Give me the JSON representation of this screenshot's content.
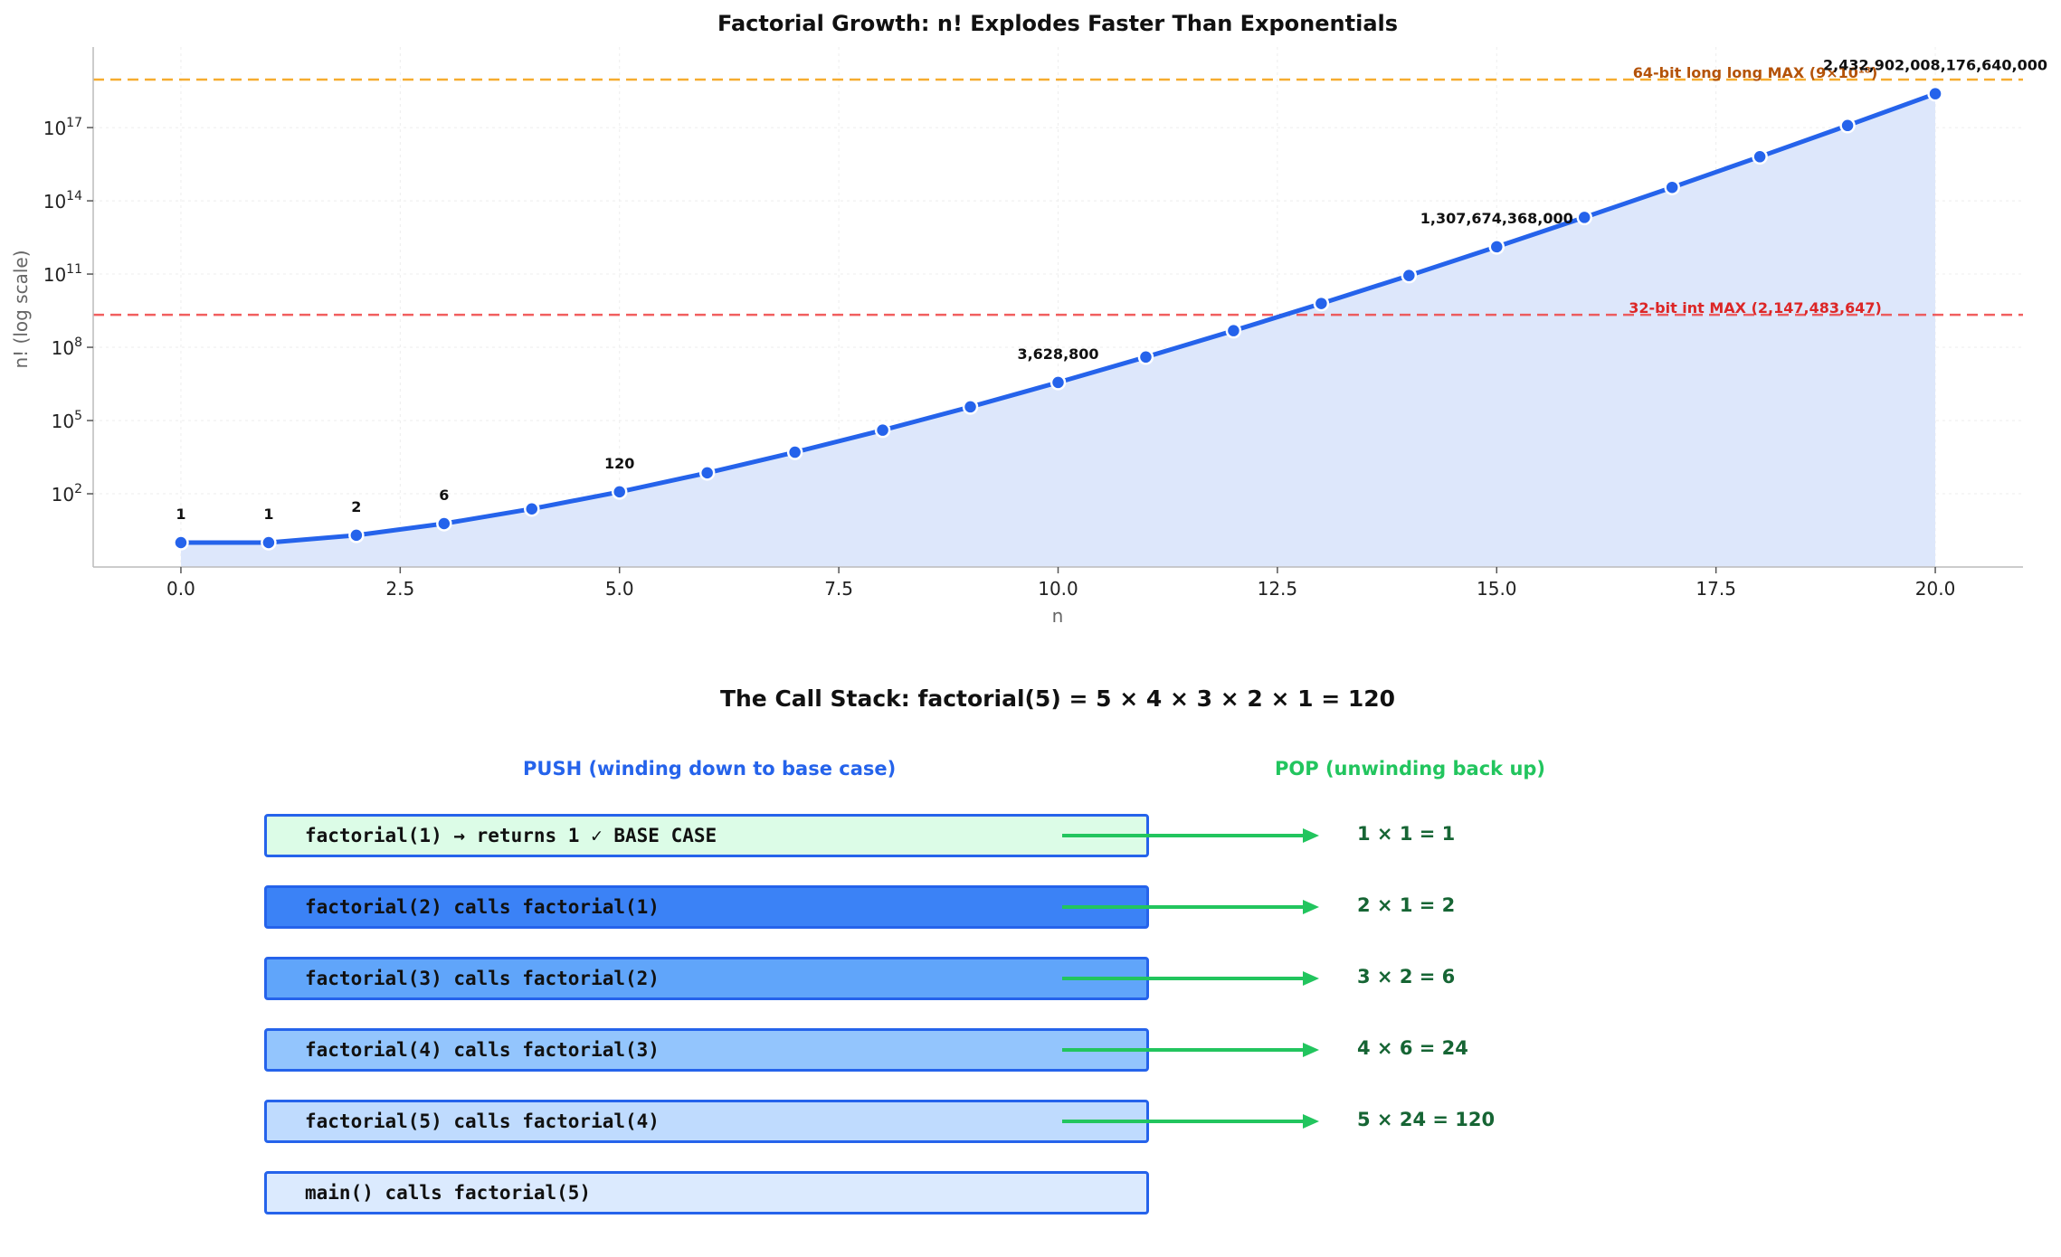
{
  "chart_data": {
    "type": "line",
    "title": "Factorial Growth: n! Explodes Faster Than Exponentials",
    "xlabel": "n",
    "ylabel": "n! (log scale)",
    "yscale": "log",
    "xlim": [
      -1,
      21
    ],
    "ylim_log10": [
      -1,
      20.3
    ],
    "x_ticks": [
      {
        "value": 0,
        "label": "0.0"
      },
      {
        "value": 2.5,
        "label": "2.5"
      },
      {
        "value": 5,
        "label": "5.0"
      },
      {
        "value": 7.5,
        "label": "7.5"
      },
      {
        "value": 10,
        "label": "10.0"
      },
      {
        "value": 12.5,
        "label": "12.5"
      },
      {
        "value": 15,
        "label": "15.0"
      },
      {
        "value": 17.5,
        "label": "17.5"
      },
      {
        "value": 20,
        "label": "20.0"
      }
    ],
    "y_ticks": [
      {
        "exp": 2,
        "base": "10",
        "sup": "2"
      },
      {
        "exp": 5,
        "base": "10",
        "sup": "5"
      },
      {
        "exp": 8,
        "base": "10",
        "sup": "8"
      },
      {
        "exp": 11,
        "base": "10",
        "sup": "11"
      },
      {
        "exp": 14,
        "base": "10",
        "sup": "14"
      },
      {
        "exp": 17,
        "base": "10",
        "sup": "17"
      }
    ],
    "grid": true,
    "series": [
      {
        "x": [
          0,
          1,
          2,
          3,
          4,
          5,
          6,
          7,
          8,
          9,
          10,
          11,
          12,
          13,
          14,
          15,
          16,
          17,
          18,
          19,
          20
        ],
        "values": [
          1,
          1,
          2,
          6,
          24,
          120,
          720,
          5040,
          40320,
          362880,
          3628800,
          39916800,
          479001600,
          6227020800,
          87178291200,
          1307674368000,
          20922789888000,
          355687428096000,
          6402373705728000,
          121645100408832000,
          2432902008176640000
        ]
      }
    ],
    "line_color": "#2563eb",
    "fill_color": "#dde7fb",
    "annotations": [
      {
        "x": 0,
        "text": "1"
      },
      {
        "x": 1,
        "text": "1"
      },
      {
        "x": 2,
        "text": "2"
      },
      {
        "x": 3,
        "text": "6"
      },
      {
        "x": 5,
        "text": "120"
      },
      {
        "x": 10,
        "text": "3,628,800"
      },
      {
        "x": 15,
        "text": "1,307,674,368,000"
      },
      {
        "x": 20,
        "text": "2,432,902,008,176,640,000"
      }
    ],
    "reference_lines": [
      {
        "value": 9.223372036854776e+18,
        "label": "64-bit long long MAX (9×10¹⁸)",
        "color": "#f59e0b",
        "label_color": "#b45309"
      },
      {
        "value": 2147483647,
        "label": "32-bit int MAX (2,147,483,647)",
        "color": "#ef4444",
        "label_color": "#dc2626"
      }
    ]
  },
  "call_stack": {
    "title": "The Call Stack: factorial(5) = 5 × 4 × 3 × 2 × 1 = 120",
    "push_heading": "PUSH (winding down to base case)",
    "pop_heading": "POP (unwinding back up)",
    "arrow_color": "#22c55e",
    "frames": [
      {
        "text": "factorial(1) → returns 1  ✓ BASE CASE",
        "color": "#dcfce7",
        "pop": "1 × 1 = 1"
      },
      {
        "text": "factorial(2) calls factorial(1)",
        "color": "#3b82f6",
        "pop": "2 × 1 = 2"
      },
      {
        "text": "factorial(3) calls factorial(2)",
        "color": "#60a5fa",
        "pop": "3 × 2 = 6"
      },
      {
        "text": "factorial(4) calls factorial(3)",
        "color": "#93c5fd",
        "pop": "4 × 6 = 24"
      },
      {
        "text": "factorial(5) calls factorial(4)",
        "color": "#bfdbfe",
        "pop": "5 × 24 = 120"
      },
      {
        "text": "main() calls factorial(5)",
        "color": "#dbeafe",
        "pop": ""
      }
    ]
  }
}
